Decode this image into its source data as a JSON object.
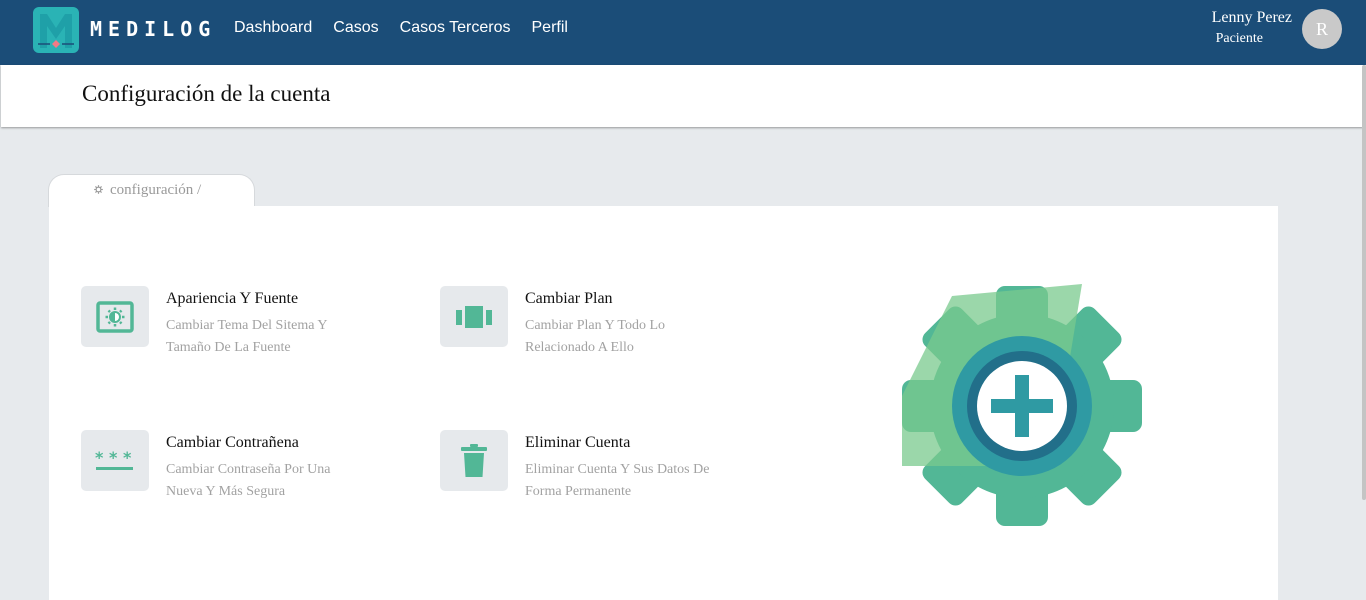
{
  "nav": {
    "brand": "MEDILOG",
    "links": [
      "Dashboard",
      "Casos",
      "Casos Terceros",
      "Perfil"
    ],
    "user": {
      "name": "Lenny Perez",
      "role": "Paciente",
      "initial": "R"
    }
  },
  "page": {
    "title": "Configuración de la cuenta"
  },
  "breadcrumb": {
    "label": "configuración /",
    "icon": "gear-icon"
  },
  "options": [
    {
      "title": "Apariencia Y Fuente",
      "desc": [
        "Cambiar Tema Del Sitema Y",
        "Tamaño De La Fuente"
      ],
      "icon": "brightness-icon"
    },
    {
      "title": "Cambiar Plan",
      "desc": [
        "Cambiar Plan Y Todo Lo",
        "Relacionado A Ello"
      ],
      "icon": "carousel-icon"
    },
    {
      "title": "Cambiar Contrañena",
      "desc": [
        "Cambiar Contraseña Por Una",
        "Nueva Y Más Segura"
      ],
      "icon": "password-icon"
    },
    {
      "title": "Eliminar Cuenta",
      "desc": [
        "Eliminar Cuenta Y Sus Datos De",
        "Forma Permanente"
      ],
      "icon": "trash-icon"
    }
  ],
  "colors": {
    "navbar": "#1b4d78",
    "accent": "#52b796",
    "icon_bg": "#e6e9ec",
    "page_bg": "#e7eaed"
  }
}
